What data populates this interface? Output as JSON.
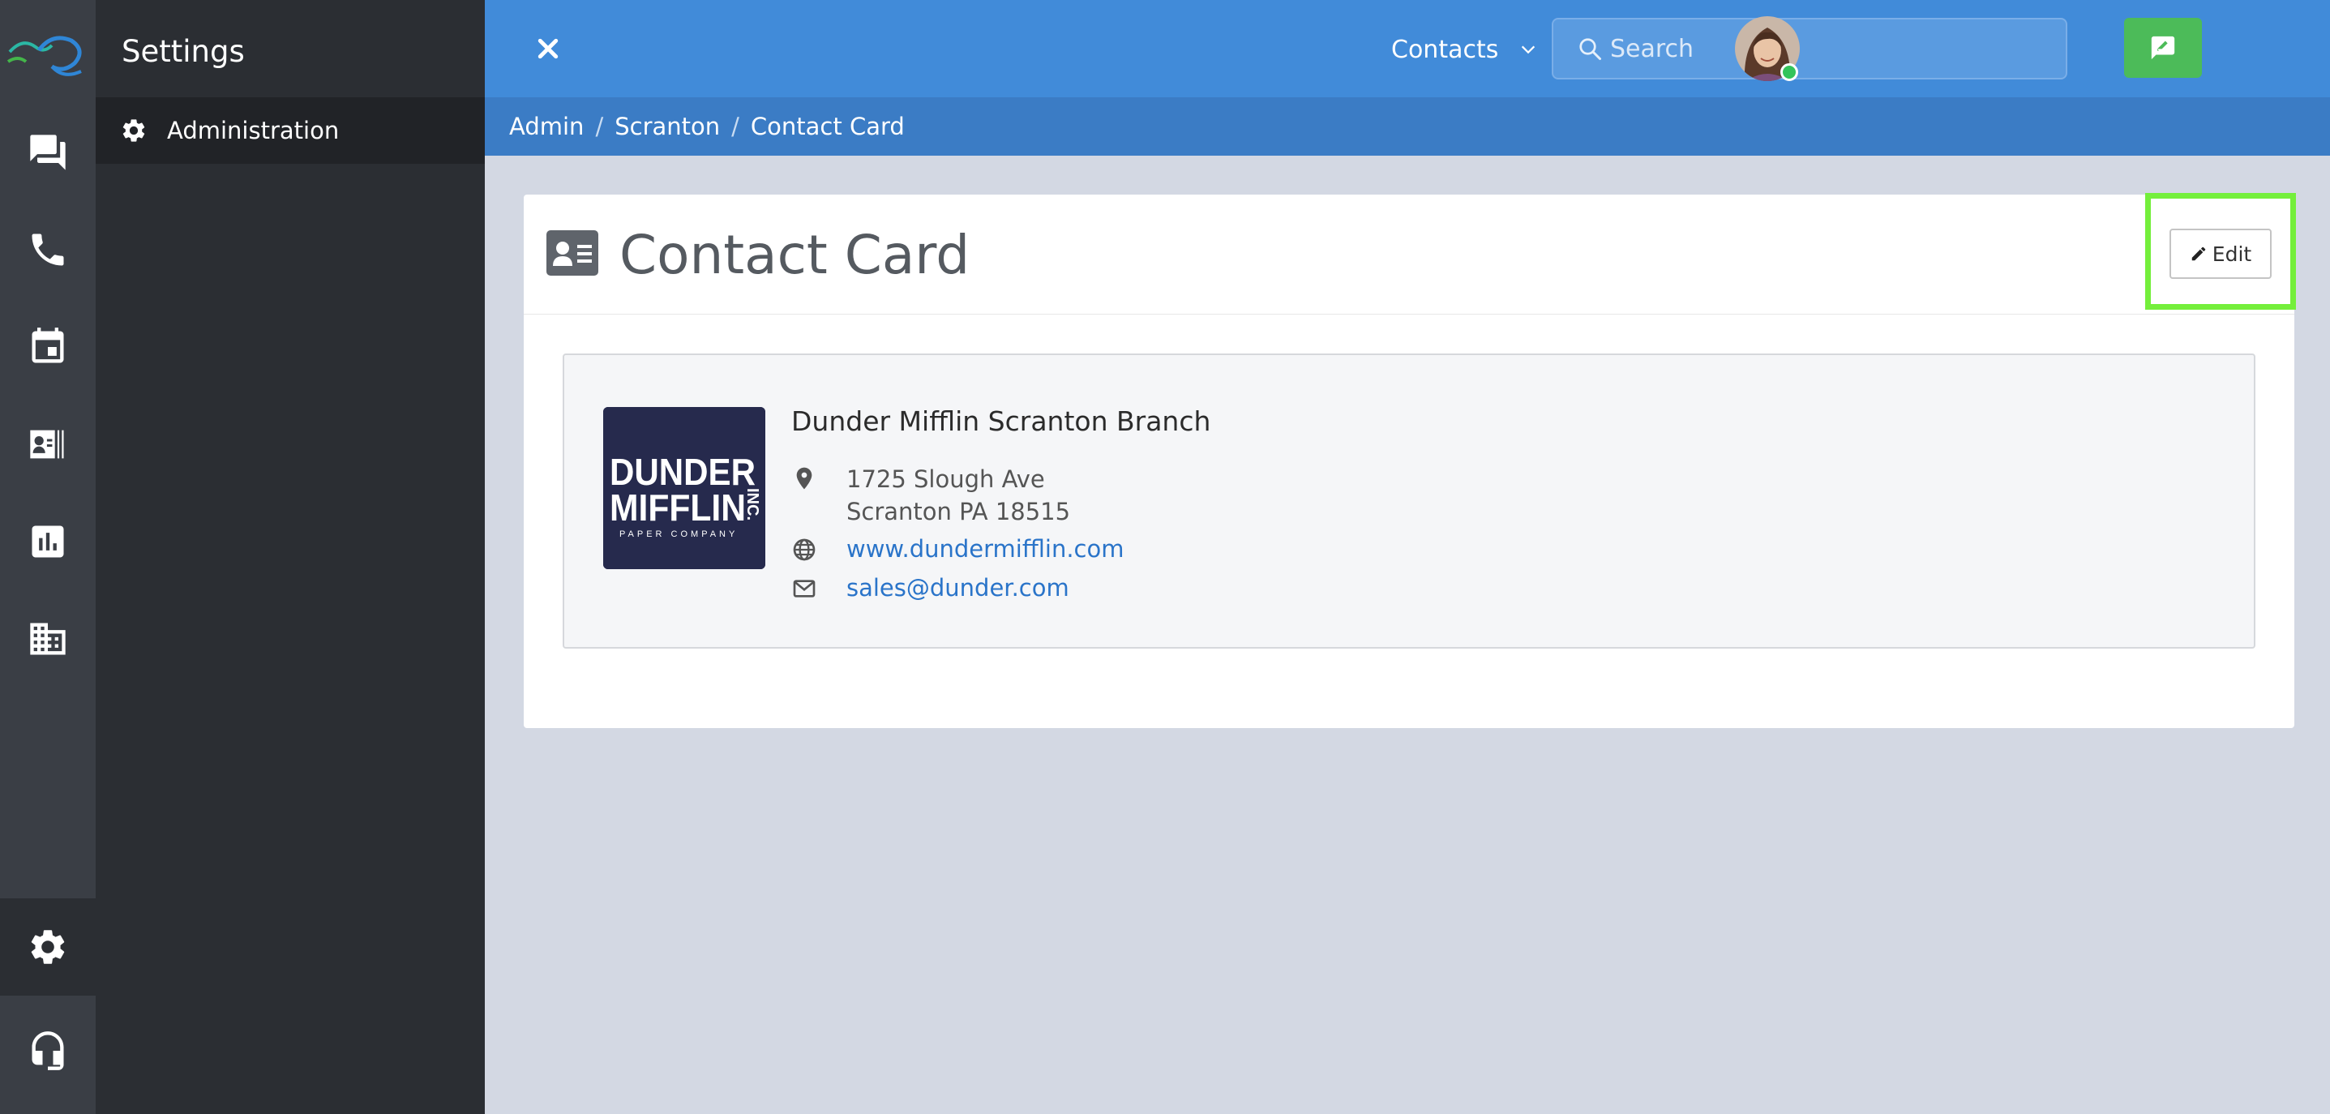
{
  "sidebar": {
    "title": "Settings",
    "items": [
      {
        "label": "Administration",
        "icon": "gear-icon"
      }
    ]
  },
  "rail": {
    "icons": [
      "chat-icon",
      "phone-icon",
      "calendar-icon",
      "contact-card-icon",
      "chart-icon",
      "building-icon",
      "settings-gear-icon",
      "headset-icon"
    ]
  },
  "topbar": {
    "dropdown_label": "Contacts",
    "search_placeholder": "Search"
  },
  "breadcrumb": [
    "Admin",
    "Scranton",
    "Contact Card"
  ],
  "card": {
    "title": "Contact Card",
    "edit_label": "Edit"
  },
  "contact": {
    "logo_text_line1": "DUNDER",
    "logo_text_line2": "MIFFLIN",
    "logo_suffix": "INC.",
    "logo_tagline": "PAPER COMPANY",
    "name": "Dunder Mifflin Scranton Branch",
    "address_line1": "1725 Slough Ave",
    "address_line2": "Scranton PA 18515",
    "website": "www.dundermifflin.com",
    "email": "sales@dunder.com"
  },
  "colors": {
    "topbar": "#418bd9",
    "breadcrumb_bar": "#3b7cc5",
    "accent_green": "#4cbb59",
    "highlight": "#74ef3b",
    "link": "#2a74c9"
  }
}
